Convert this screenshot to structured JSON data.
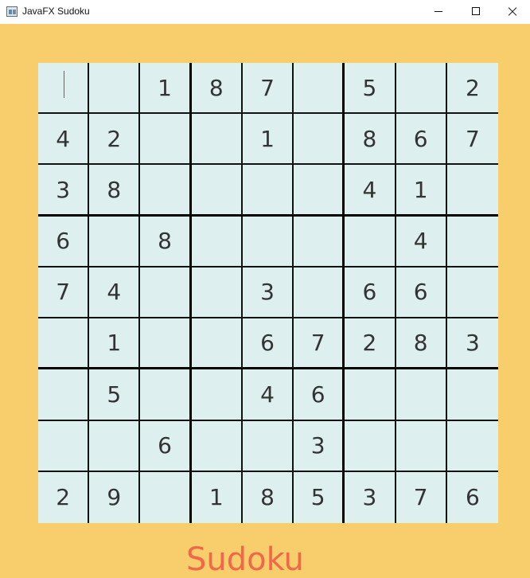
{
  "window": {
    "title": "JavaFX Sudoku",
    "icon": "app-window-icon",
    "controls": [
      "minimize-icon",
      "maximize-icon",
      "close-icon"
    ],
    "background_color": "#F7CE6B"
  },
  "board": {
    "cell_color": "#DEEFF0",
    "text_color": "#333333",
    "focused_cell": [
      0,
      0
    ],
    "rows": [
      [
        "",
        "",
        "1",
        "8",
        "7",
        "",
        "5",
        "",
        "2"
      ],
      [
        "4",
        "2",
        "",
        "",
        "1",
        "",
        "8",
        "6",
        "7"
      ],
      [
        "3",
        "8",
        "",
        "",
        "",
        "",
        "4",
        "1",
        ""
      ],
      [
        "6",
        "",
        "8",
        "",
        "",
        "",
        "",
        "4",
        ""
      ],
      [
        "7",
        "4",
        "",
        "",
        "3",
        "",
        "6",
        "6",
        ""
      ],
      [
        "",
        "1",
        "",
        "",
        "6",
        "7",
        "2",
        "8",
        "3"
      ],
      [
        "",
        "5",
        "",
        "",
        "4",
        "6",
        "",
        "",
        ""
      ],
      [
        "",
        "",
        "6",
        "",
        "",
        "3",
        "",
        "",
        ""
      ],
      [
        "2",
        "9",
        "",
        "1",
        "8",
        "5",
        "3",
        "7",
        "6"
      ]
    ]
  },
  "footer": {
    "title": "Sudoku",
    "color": "#F2674A"
  }
}
